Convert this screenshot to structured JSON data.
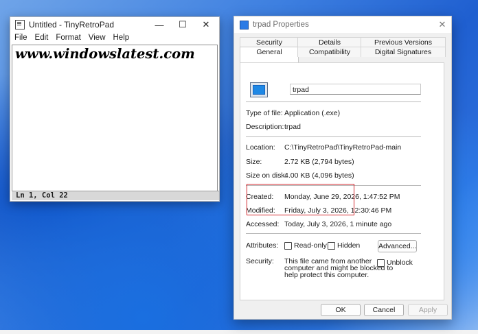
{
  "notepad": {
    "title": "Untitled - TinyRetroPad",
    "controls": {
      "minimize": "—",
      "maximize": "☐",
      "close": "✕"
    },
    "menu": [
      "File",
      "Edit",
      "Format",
      "View",
      "Help"
    ],
    "content": "www.windowslatest.com",
    "status": "Ln 1, Col 22"
  },
  "dialog": {
    "title": "trpad Properties",
    "close": "✕",
    "tabs_row1": [
      "Security",
      "Details",
      "Previous Versions"
    ],
    "tabs_row2": [
      "General",
      "Compatibility",
      "Digital Signatures"
    ],
    "active_tab": "General",
    "file_name": "trpad",
    "type_label": "Type of file:",
    "type_value": "Application (.exe)",
    "desc_label": "Description:",
    "desc_value": "trpad",
    "location_label": "Location:",
    "location_value": "C:\\TinyRetroPad\\TinyRetroPad-main",
    "size_label": "Size:",
    "size_value": "2.72 KB (2,794 bytes)",
    "size_disk_label": "Size on disk:",
    "size_disk_value": "4.00 KB (4,096 bytes)",
    "created_label": "Created:",
    "created_value": "Monday, June 29, 2026, 1:47:52 PM",
    "modified_label": "Modified:",
    "modified_value": "Friday, July 3, 2026, 12:30:46 PM",
    "accessed_label": "Accessed:",
    "accessed_value": "Today, July 3, 2026, 1 minute ago",
    "attributes_label": "Attributes:",
    "readonly_label": "Read-only",
    "hidden_label": "Hidden",
    "advanced_label": "Advanced...",
    "security_label": "Security:",
    "security_line1": "This file came from another",
    "security_line2": "computer and might be blocked to",
    "security_line3": "help protect this computer.",
    "unblock_label": "Unblock",
    "ok_label": "OK",
    "cancel_label": "Cancel",
    "apply_label": "Apply"
  },
  "colors": {
    "highlight_box": "#d3262c",
    "desktop_blue": "#1f5fd0"
  }
}
